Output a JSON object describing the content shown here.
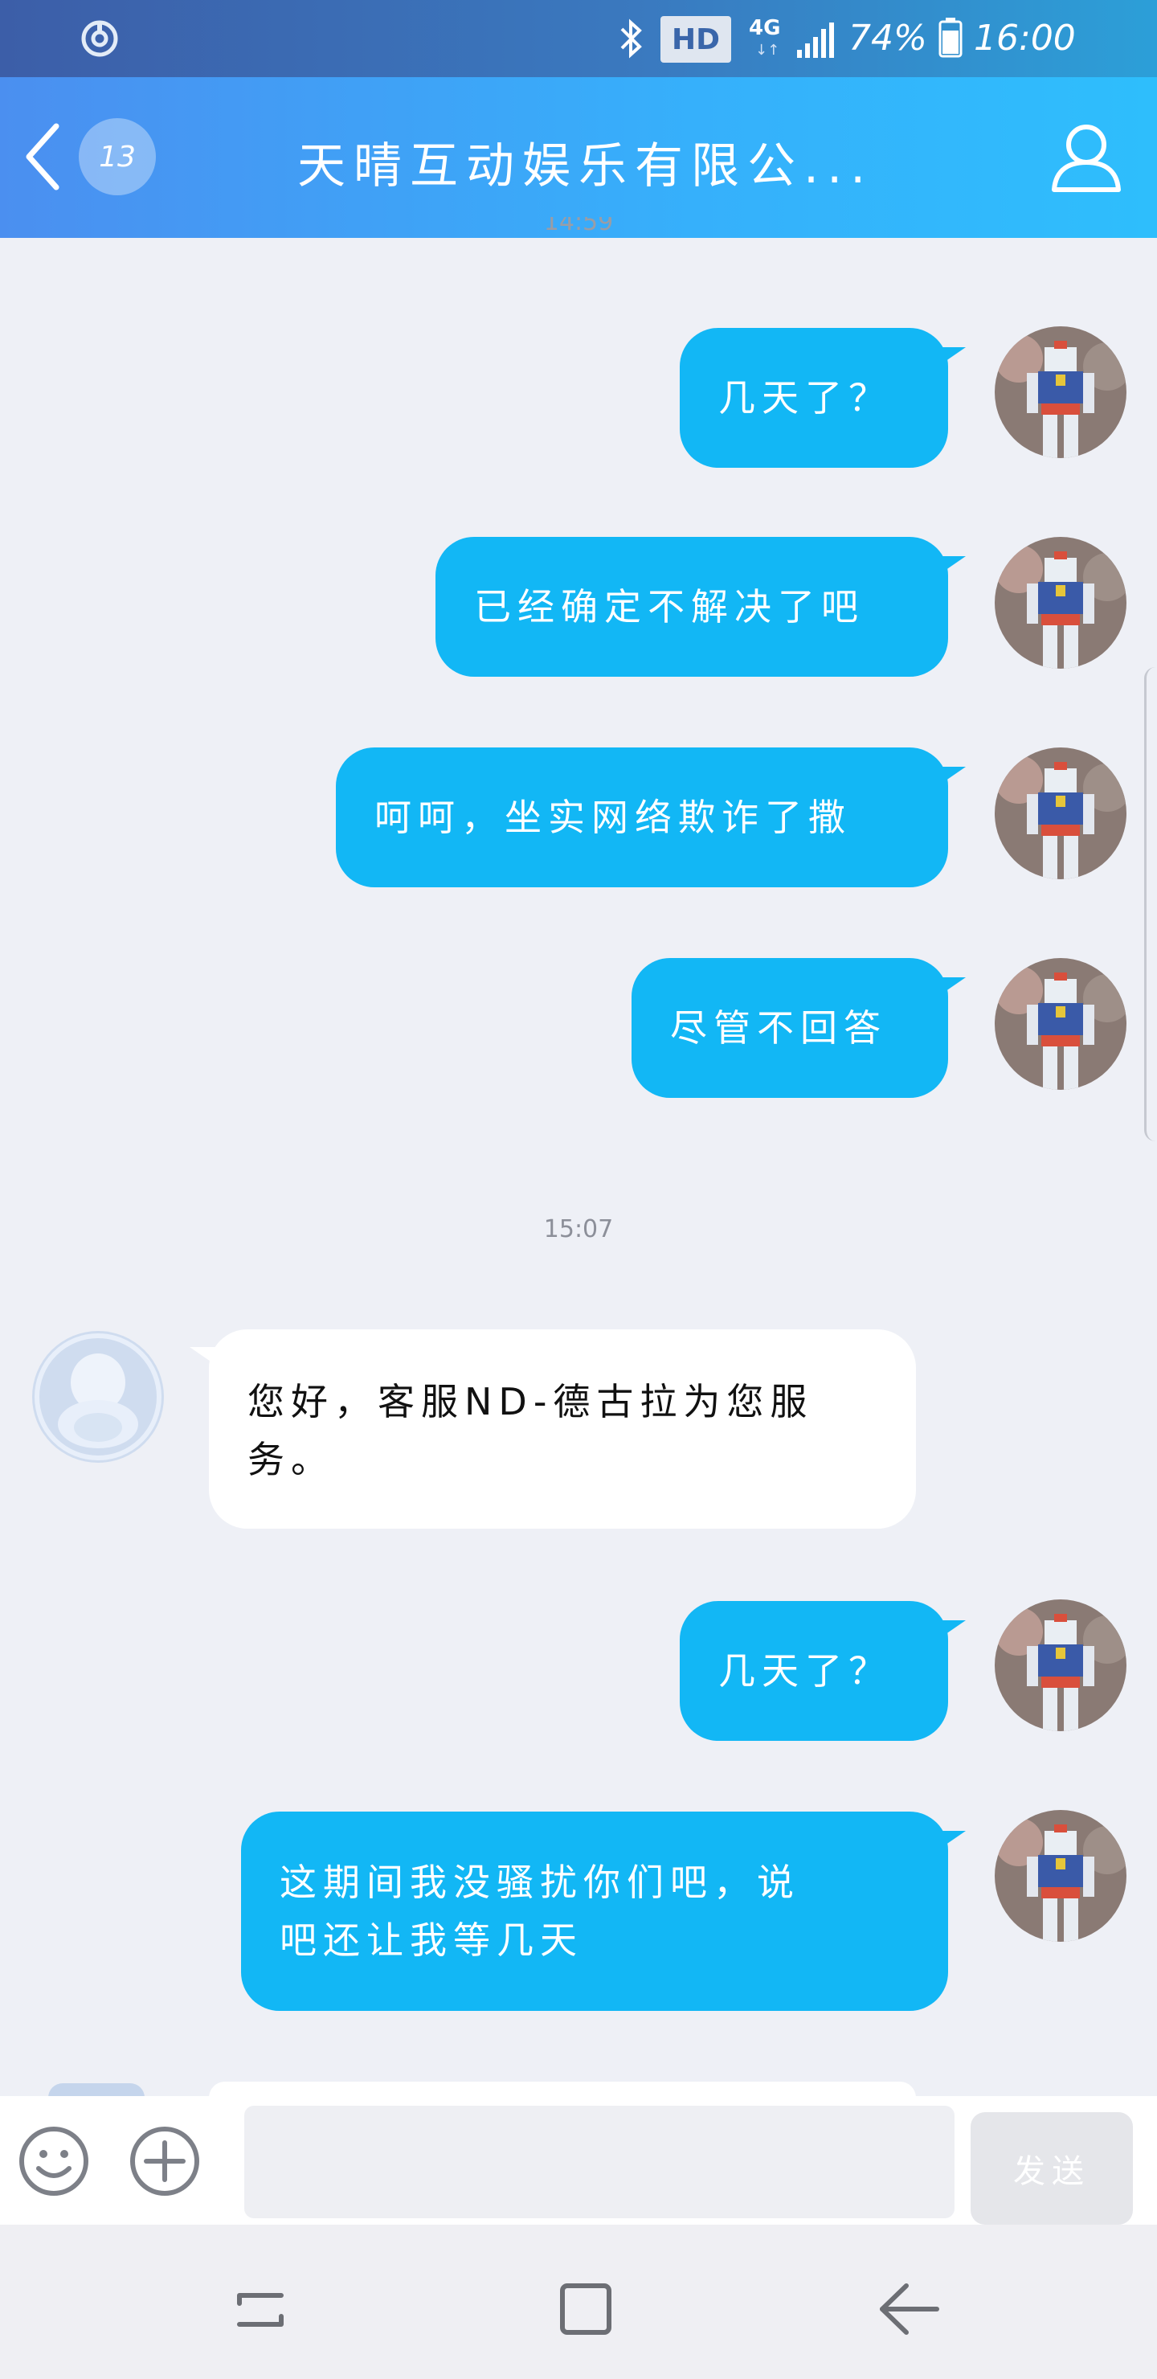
{
  "status_bar": {
    "hd_label": "HD",
    "network_label": "4G",
    "network_arrows": "↓↑",
    "battery_percent": "74%",
    "time": "16:00"
  },
  "header": {
    "unread_count": "13",
    "title": "天晴互动娱乐有限公..."
  },
  "messages": {
    "time_partial": "14:59",
    "time_divider": "15:07",
    "m1": "几天了？",
    "m2": "已经确定不解决了吧",
    "m3": "呵呵，坐实网络欺诈了撒",
    "m4": "尽管不回答",
    "m5_line1": "您好，客服ND-德古拉为您服",
    "m5_line2": "务。",
    "m6": "几天了？",
    "m7_line1": "这期间我没骚扰你们吧，说",
    "m7_line2": "吧还让我等几天"
  },
  "input_bar": {
    "placeholder": "",
    "send_label": "发送"
  },
  "colors": {
    "out_bubble": "#12b7f5",
    "header_start": "#4b8ff0",
    "header_end": "#2ebefc"
  },
  "icons": [
    "app-icon",
    "bluetooth-icon",
    "signal-icon",
    "battery-icon",
    "back-icon",
    "profile-icon",
    "emoji-icon",
    "plus-icon",
    "recent-apps-icon",
    "home-icon",
    "nav-back-icon"
  ]
}
